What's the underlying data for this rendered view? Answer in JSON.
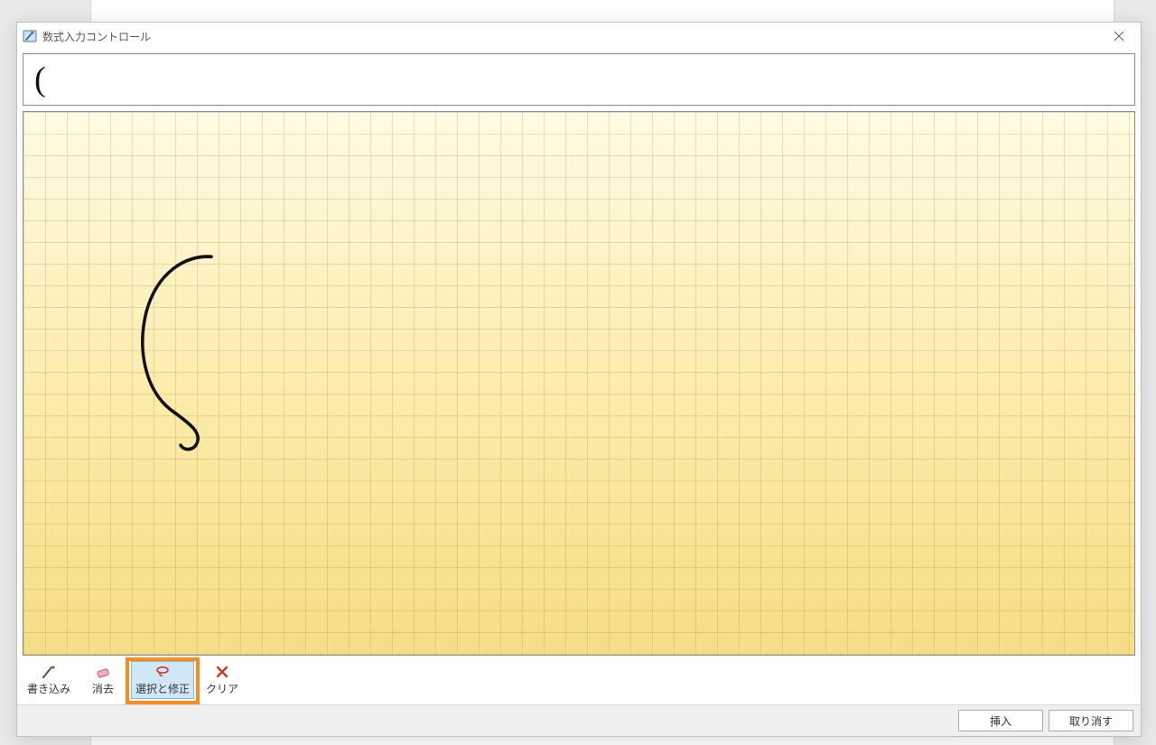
{
  "window": {
    "title": "数式入力コントロール"
  },
  "preview": {
    "content": "("
  },
  "tools": {
    "write": {
      "label": "書き込み"
    },
    "erase": {
      "label": "消去"
    },
    "select": {
      "label": "選択と修正"
    },
    "clear": {
      "label": "クリア"
    }
  },
  "buttons": {
    "insert": "挿入",
    "cancel": "取り消す"
  },
  "highlight": {
    "target": "select-tool"
  }
}
